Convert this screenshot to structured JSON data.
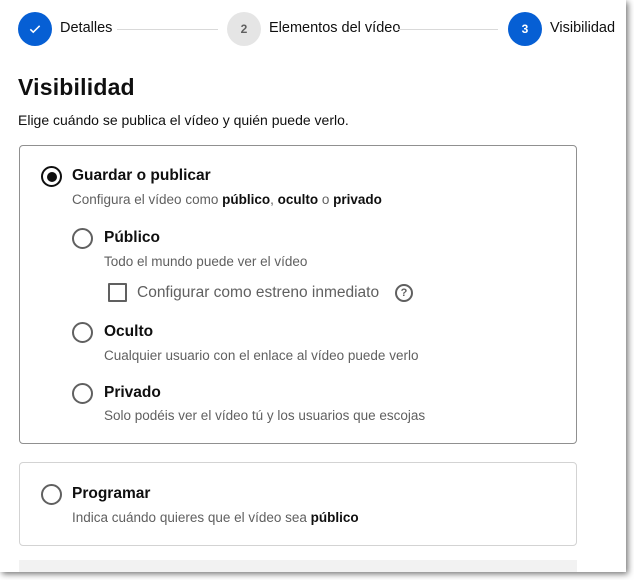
{
  "stepper": {
    "steps": [
      {
        "number": "",
        "label": "Detalles",
        "state": "done",
        "icon": "checkmark-icon"
      },
      {
        "number": "2",
        "label": "Elementos del vídeo",
        "state": "pending"
      },
      {
        "number": "3",
        "label": "Visibilidad",
        "state": "active"
      }
    ]
  },
  "header": {
    "title": "Visibilidad",
    "subtitle": "Elige cuándo se publica el vídeo y quién puede verlo."
  },
  "save_publish": {
    "label": "Guardar o publicar",
    "desc_prefix": "Configura el vídeo como ",
    "desc_publico": "público",
    "desc_sep1": ", ",
    "desc_oculto": "oculto",
    "desc_sep2": " o ",
    "desc_privado": "privado",
    "selected": true,
    "options": {
      "publico": {
        "label": "Público",
        "desc": "Todo el mundo puede ver el vídeo",
        "selected": false
      },
      "premiere": {
        "label": "Configurar como estreno inmediato",
        "help_icon": "question-circle-icon",
        "checked": false
      },
      "oculto": {
        "label": "Oculto",
        "desc": "Cualquier usuario con el enlace al vídeo puede verlo",
        "selected": false
      },
      "privado": {
        "label": "Privado",
        "desc": "Solo podéis ver el vídeo tú y los usuarios que escojas",
        "selected": false
      }
    }
  },
  "schedule": {
    "label": "Programar",
    "desc_prefix": "Indica cuándo quieres que el vídeo sea ",
    "desc_bold": "público",
    "selected": false
  },
  "colors": {
    "accent": "#065fd4",
    "text": "#0f0f0f",
    "secondary_text": "#606060"
  }
}
